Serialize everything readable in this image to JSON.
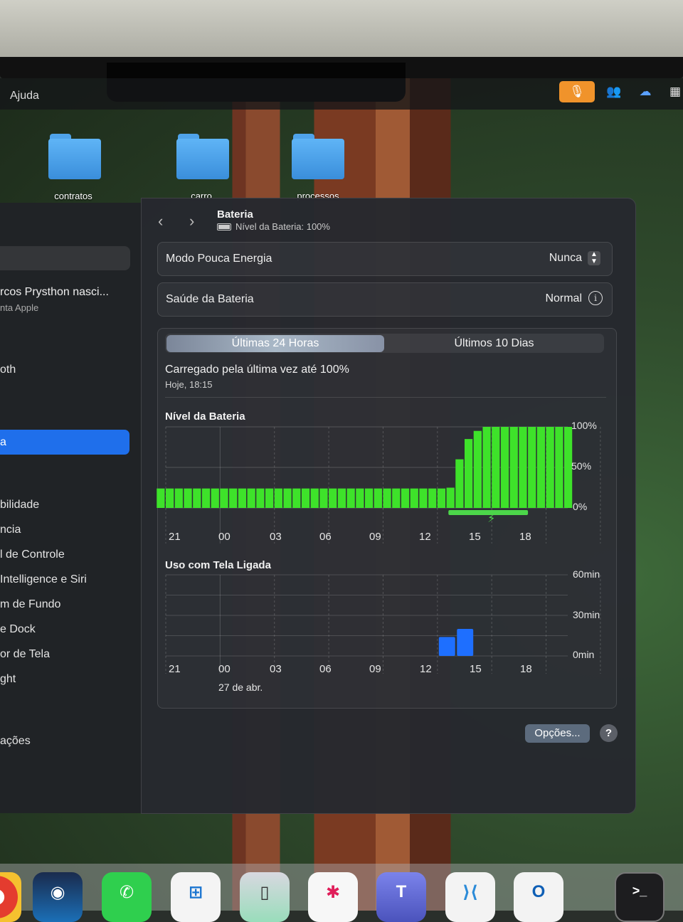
{
  "menubar": {
    "help_label": "Ajuda"
  },
  "desktop": {
    "folders": [
      "contratos",
      "carro",
      "processos"
    ]
  },
  "sidebar": {
    "user_name": "rcos  Prysthon nasci...",
    "user_sub": "nta Apple",
    "items": [
      "oth",
      "bilidade",
      "ncia",
      "l de Controle",
      "Intelligence e Siri",
      "m de Fundo",
      "e Dock",
      "or de Tela",
      "ght",
      "ações"
    ],
    "selected_label": "a"
  },
  "header": {
    "title": "Bateria",
    "subtitle": "Nível da Bateria: 100%"
  },
  "settings": {
    "low_power_label": "Modo Pouca Energia",
    "low_power_value": "Nunca",
    "health_label": "Saúde da Bateria",
    "health_value": "Normal"
  },
  "tabs": {
    "active": "Últimas 24 Horas",
    "inactive": "Últimos 10 Dias"
  },
  "last_charge": {
    "text": "Carregado pela última vez até 100%",
    "time": "Hoje, 18:15"
  },
  "colors": {
    "battery_green": "#3ee22a",
    "charging_green": "#4cd64a",
    "usage_blue": "#1e6fff",
    "accent": "#1f6feb"
  },
  "chart_data": [
    {
      "type": "bar",
      "title": "Nível da Bateria",
      "x_ticks": [
        "21",
        "00",
        "03",
        "06",
        "09",
        "12",
        "15",
        "18"
      ],
      "y_ticks": [
        "100%",
        "50%",
        "0%"
      ],
      "ylim": [
        0,
        100
      ],
      "hours": [
        20.5,
        21,
        21.5,
        22,
        22.5,
        23,
        23.5,
        0,
        0.5,
        1,
        1.5,
        2,
        2.5,
        3,
        3.5,
        4,
        4.5,
        5,
        5.5,
        6,
        6.5,
        7,
        7.5,
        8,
        8.5,
        9,
        9.5,
        10,
        10.5,
        11,
        11.5,
        12,
        12.5,
        13,
        13.5,
        14,
        14.5,
        15,
        15.5,
        16,
        16.5,
        17,
        17.5,
        18,
        18.5,
        19
      ],
      "values": [
        24,
        24,
        24,
        24,
        24,
        24,
        24,
        24,
        24,
        24,
        24,
        24,
        24,
        24,
        24,
        24,
        24,
        24,
        24,
        24,
        24,
        24,
        24,
        24,
        24,
        24,
        24,
        24,
        24,
        24,
        24,
        24,
        25,
        60,
        85,
        95,
        100,
        100,
        100,
        100,
        100,
        100,
        100,
        100,
        100,
        100
      ],
      "charging_period": [
        13,
        19
      ]
    },
    {
      "type": "bar",
      "title": "Uso com Tela Ligada",
      "x_ticks": [
        "21",
        "00",
        "03",
        "06",
        "09",
        "12",
        "15",
        "18"
      ],
      "x_sub_label": "27 de abr.",
      "y_ticks": [
        "60min",
        "30min",
        "0min"
      ],
      "ylim": [
        0,
        60
      ],
      "bars": [
        {
          "hour": 12,
          "minutes": 14
        },
        {
          "hour": 13,
          "minutes": 20
        }
      ]
    }
  ],
  "buttons": {
    "options_label": "Opções...",
    "help_label": "?"
  },
  "dock": {
    "apps": [
      "chrome",
      "steam",
      "whatsapp",
      "windows-app",
      "iphone-mirroring",
      "slack",
      "teams",
      "vscode",
      "outlook",
      "terminal"
    ]
  }
}
